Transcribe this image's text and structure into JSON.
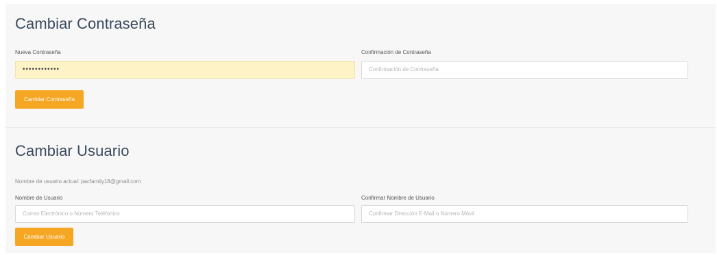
{
  "change_password": {
    "title": "Cambiar Contraseña",
    "new_password_label": "Nueva Contraseña",
    "new_password_value": "••••••••••••",
    "confirm_label": "Confirmación de Contraseña",
    "confirm_placeholder": "Confirmación de Contraseña",
    "submit_label": "Cambiar Contraseña"
  },
  "change_user": {
    "title": "Cambiar Usuario",
    "current_user_text": "Nombre de usuario actual: pacfamily18@gmail.com",
    "username_label": "Nombre de Usuario",
    "username_placeholder": "Correo Electrónico o Número Teléfonico",
    "confirm_label": "Confirmar Nombre de Usuario",
    "confirm_placeholder": "Confirmar Dirección E-Mail o Número Móvil",
    "submit_label": "Cambiar Usuario"
  },
  "colors": {
    "accent": "#f5a623",
    "autofill": "#fdf3c7",
    "title": "#3b4a5c"
  }
}
